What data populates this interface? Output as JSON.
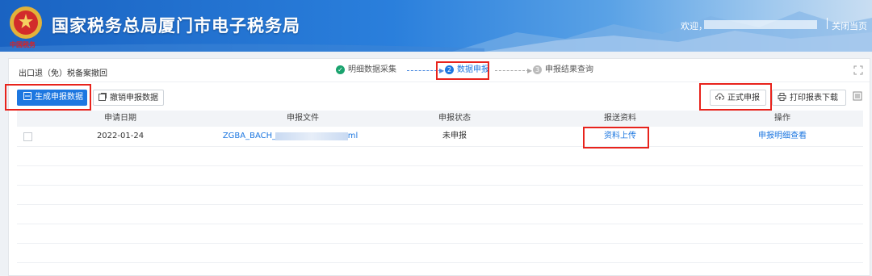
{
  "header": {
    "title": "国家税务总局厦门市电子税务局",
    "emblem_text": "中国税务",
    "welcome": "欢迎，",
    "close_label": "关闭当页"
  },
  "breadcrumb": "出口退（免）税备案撤回",
  "steps": [
    {
      "num": "✓",
      "label": "明细数据采集",
      "state": "done"
    },
    {
      "num": "2",
      "label": "数据申报",
      "state": "active"
    },
    {
      "num": "3",
      "label": "申报结果查询",
      "state": "pending"
    }
  ],
  "toolbar": {
    "generate_label": "生成申报数据",
    "cancel_label": "撤销申报数据",
    "formal_label": "正式申报",
    "print_label": "打印报表下载"
  },
  "table": {
    "columns": [
      "申请日期",
      "申报文件",
      "申报状态",
      "报送资料",
      "操作"
    ],
    "rows": [
      {
        "date": "2022-01-24",
        "file": "ZGBA_BACH_",
        "file_tail": "ml",
        "status": "未申报",
        "upload": "资料上传",
        "action": "申报明细查看"
      }
    ]
  },
  "colors": {
    "primary": "#1d77e0",
    "highlight": "#e8231c",
    "done": "#1aa36e"
  },
  "icons": [
    "emblem-icon",
    "expand-icon",
    "generate-icon",
    "cancel-icon",
    "upload-cloud-icon",
    "print-icon",
    "settings-icon"
  ]
}
